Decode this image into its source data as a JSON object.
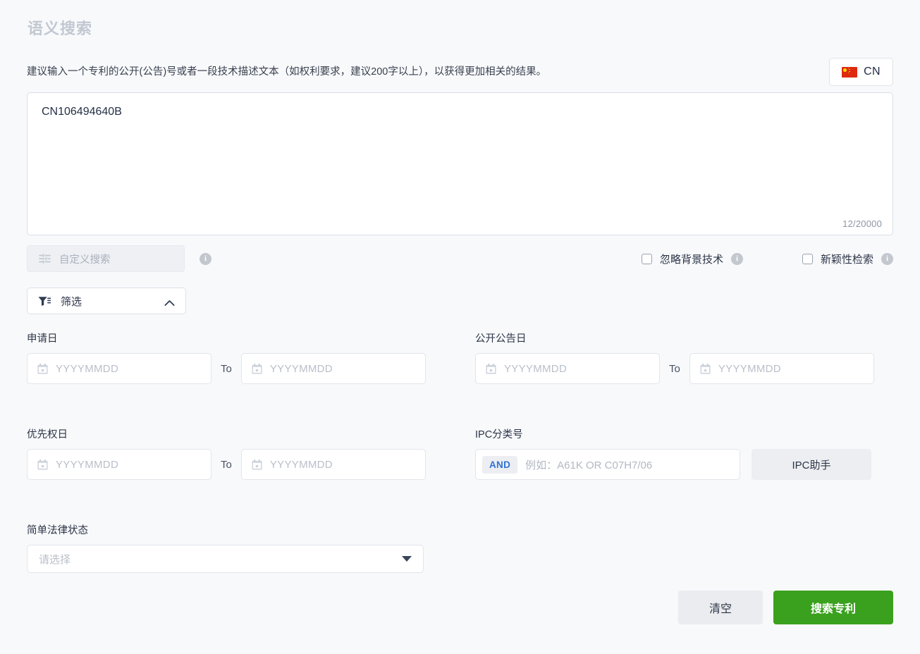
{
  "page": {
    "title": "语义搜索"
  },
  "instruction": {
    "text": "建议输入一个专利的公开(公告)号或者一段技术描述文本（如权利要求，建议200字以上），以获得更加相关的结果。"
  },
  "language": {
    "label": "CN",
    "flag_icon": "flag-cn-icon",
    "flag_red": "#de2910",
    "flag_star": "#ffde00"
  },
  "query": {
    "value": "CN106494640B",
    "counter": "12/20000",
    "max_chars": 20000,
    "current_chars": 12
  },
  "custom_search": {
    "placeholder": "自定义搜索",
    "icon": "sliders-icon",
    "info_icon": "info-icon",
    "disabled": true
  },
  "checkboxes": [
    {
      "label": "忽略背景技术",
      "checked": false,
      "info_icon": "info-icon"
    },
    {
      "label": "新颖性检索",
      "checked": false,
      "info_icon": "info-icon"
    }
  ],
  "filter_toggle": {
    "label": "筛选",
    "icon": "funnel-icon",
    "chevron": "chevron-up-icon",
    "expanded": true
  },
  "filters": {
    "application_date": {
      "label": "申请日",
      "from_placeholder": "YYYYMMDD",
      "to_placeholder": "YYYYMMDD",
      "separator": "To",
      "from_value": "",
      "to_value": ""
    },
    "publication_date": {
      "label": "公开公告日",
      "from_placeholder": "YYYYMMDD",
      "to_placeholder": "YYYYMMDD",
      "separator": "To",
      "from_value": "",
      "to_value": ""
    },
    "priority_date": {
      "label": "优先权日",
      "from_placeholder": "YYYYMMDD",
      "to_placeholder": "YYYYMMDD",
      "separator": "To",
      "from_value": "",
      "to_value": ""
    },
    "ipc": {
      "label": "IPC分类号",
      "operator": "AND",
      "placeholder": "例如：A61K OR C07H7/06",
      "value": "",
      "helper_button": "IPC助手"
    },
    "legal_status": {
      "label": "简单法律状态",
      "placeholder": "请选择",
      "value": ""
    }
  },
  "actions": {
    "clear_label": "清空",
    "search_label": "搜索专利",
    "search_color": "#3aa11e",
    "clear_color": "#ebecef"
  }
}
